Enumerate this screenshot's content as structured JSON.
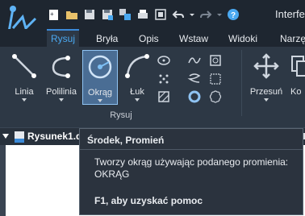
{
  "window": {
    "title": "Interfe"
  },
  "quick_access": {
    "icons": [
      "new-icon",
      "open-folder-icon",
      "save-icon",
      "save-as-icon",
      "layers-icon",
      "print-icon",
      "viewport-icon",
      "undo-icon",
      "undo-dropdown-icon",
      "redo-icon",
      "redo-dropdown-icon",
      "help-icon"
    ]
  },
  "tabs": [
    {
      "label": "Rysuj",
      "active": true
    },
    {
      "label": "Bryła",
      "active": false
    },
    {
      "label": "Opis",
      "active": false
    },
    {
      "label": "Wstaw",
      "active": false
    },
    {
      "label": "Widoki",
      "active": false
    },
    {
      "label": "Narzę",
      "active": false
    }
  ],
  "ribbon": {
    "panel_label": "Rysuj",
    "buttons": [
      {
        "label": "Linia",
        "icon": "line-icon"
      },
      {
        "label": "Polilinia",
        "icon": "polyline-icon"
      },
      {
        "label": "Okrąg",
        "icon": "circle-icon",
        "selected": true
      },
      {
        "label": "Łuk",
        "icon": "arc-icon"
      },
      {
        "label": "Przesuń",
        "icon": "move-icon"
      },
      {
        "label": "Ko",
        "icon": "copy-icon"
      }
    ]
  },
  "document": {
    "tab_label": "Rysunek1.d"
  },
  "tooltip": {
    "title": "Środek, Promień",
    "description": "Tworzy okrąg używając podanego promienia:",
    "command": "OKRĄG",
    "help": "F1, aby uzyskać pomoc"
  },
  "colors": {
    "accent": "#4aa8f0",
    "titlebar": "#1e2630",
    "ribbon": "#2d3845"
  }
}
